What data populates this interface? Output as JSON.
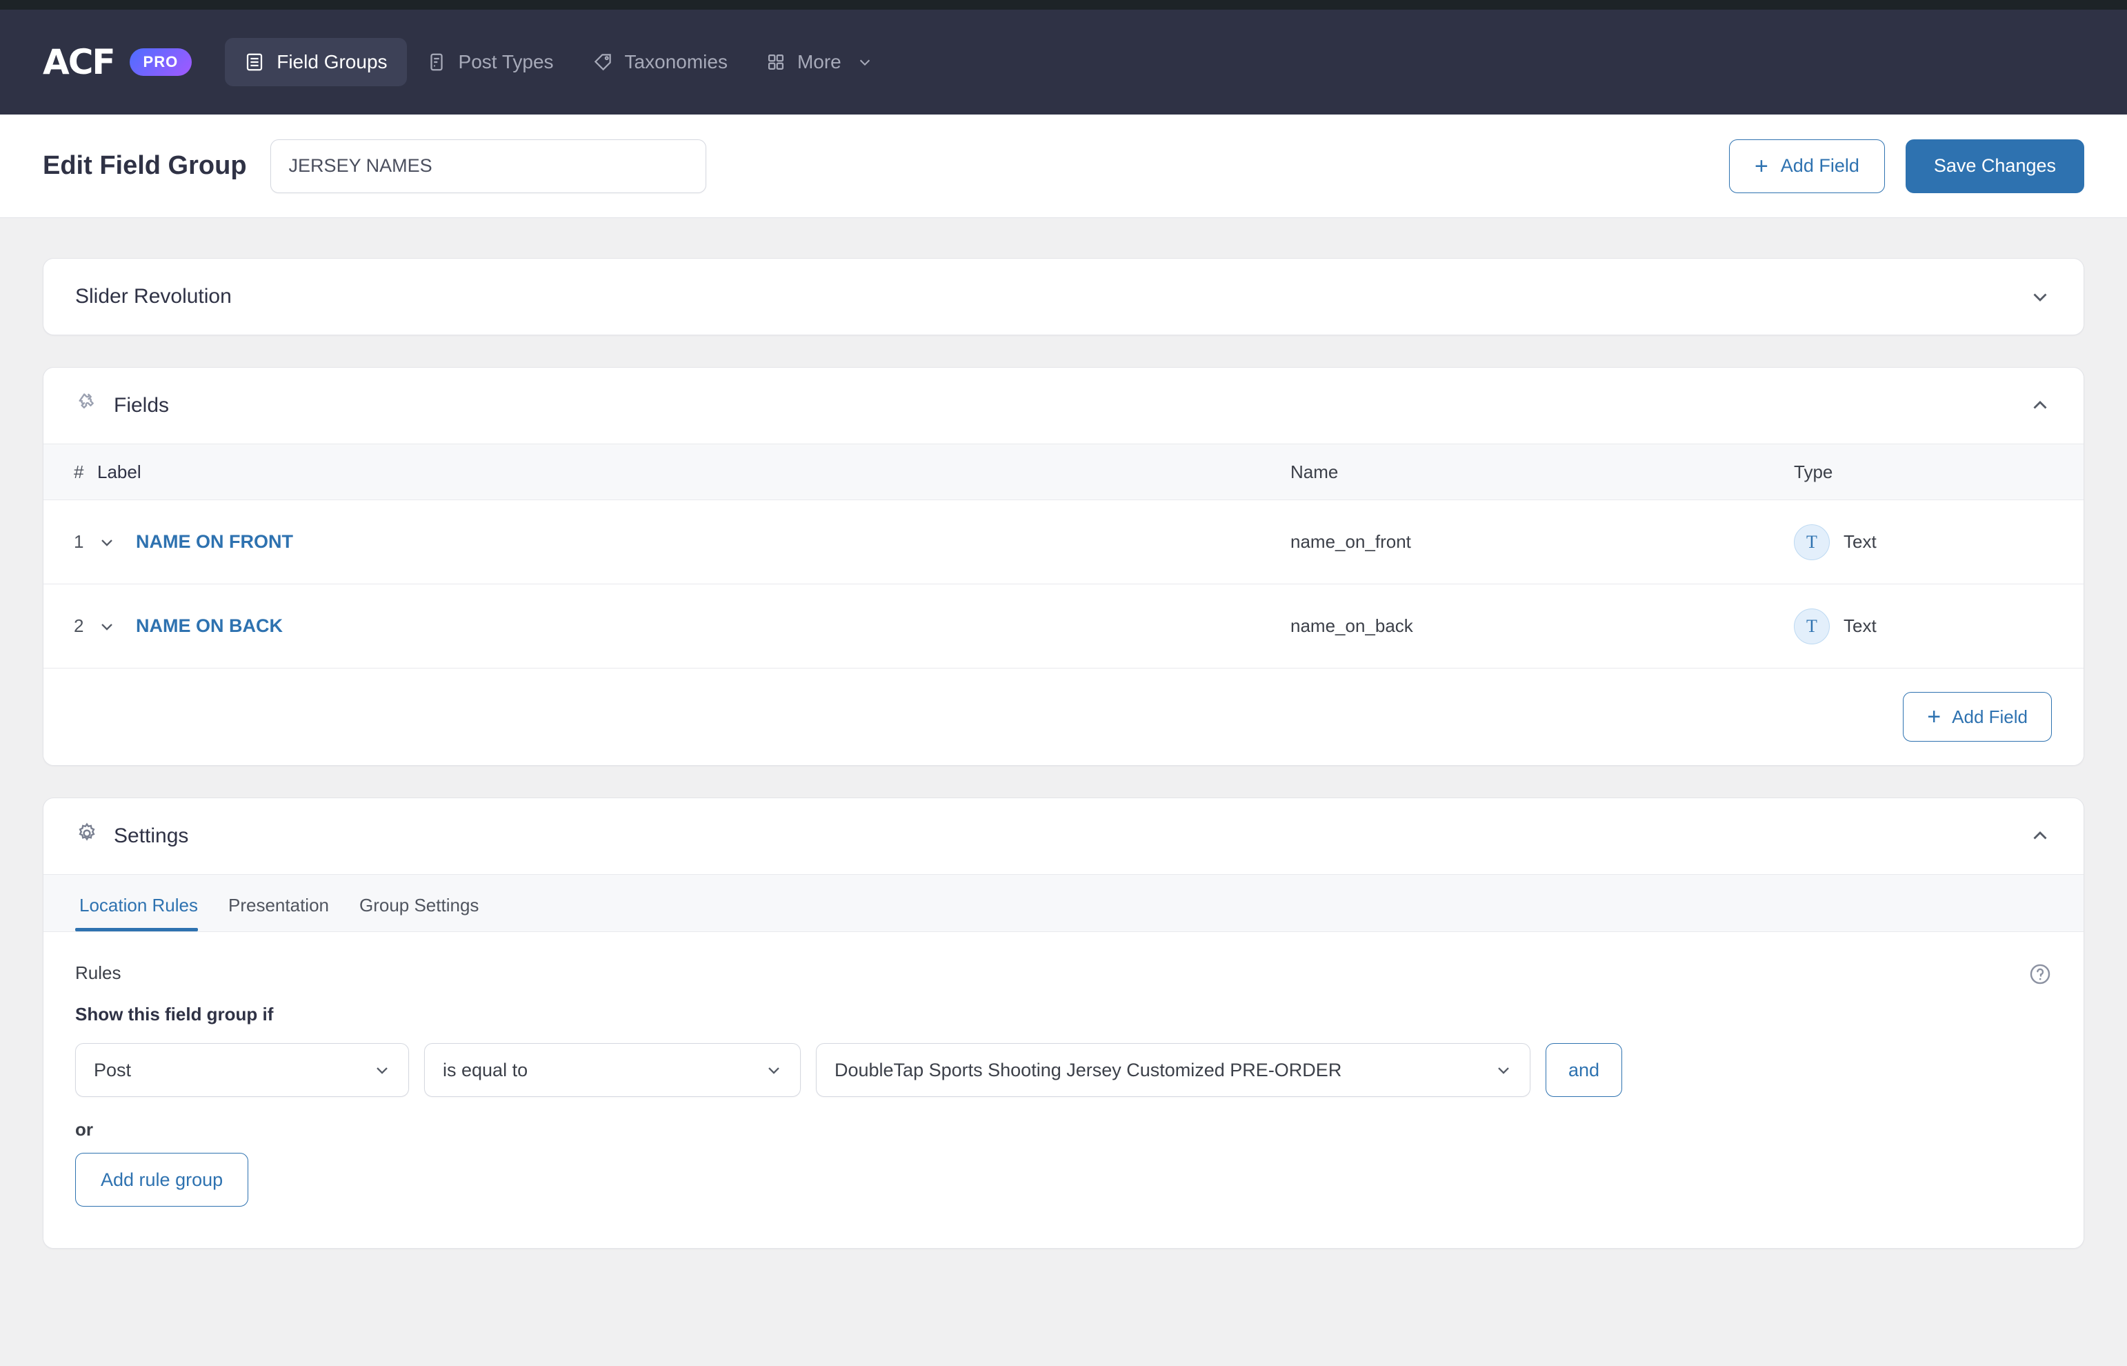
{
  "colors": {
    "nav_bg": "#2f3245",
    "accent_blue": "#2e72b0",
    "page_bg": "#f0f0f1",
    "pro_badge_gradient_start": "#4d6eff",
    "pro_badge_gradient_end": "#a259ff"
  },
  "nav": {
    "logo_text": "ACF",
    "pro_badge": "PRO",
    "items": [
      {
        "label": "Field Groups",
        "icon": "field-groups-icon",
        "active": true
      },
      {
        "label": "Post Types",
        "icon": "post-types-icon",
        "active": false
      },
      {
        "label": "Taxonomies",
        "icon": "taxonomies-tag-icon",
        "active": false
      },
      {
        "label": "More",
        "icon": "grid-icon",
        "active": false,
        "has_chevron": true
      }
    ]
  },
  "header": {
    "title": "Edit Field Group",
    "field_group_name": "JERSEY NAMES",
    "field_group_name_placeholder": "Add title",
    "add_field_label": "Add Field",
    "save_label": "Save Changes"
  },
  "panels": {
    "slider_revolution": {
      "title": "Slider Revolution",
      "collapsed": true,
      "toggle_icon": "chevron-down-icon"
    },
    "fields": {
      "title": "Fields",
      "icon": "puzzle-piece-icon",
      "collapsed": false,
      "toggle_icon": "chevron-up-icon",
      "columns": {
        "num": "#",
        "label": "Label",
        "name": "Name",
        "type": "Type"
      },
      "rows": [
        {
          "num": "1",
          "label": "NAME ON FRONT",
          "name": "name_on_front",
          "type": "Text",
          "type_glyph": "T"
        },
        {
          "num": "2",
          "label": "NAME ON BACK",
          "name": "name_on_back",
          "type": "Text",
          "type_glyph": "T"
        }
      ],
      "add_field_label": "Add Field"
    },
    "settings": {
      "title": "Settings",
      "icon": "gear-icon",
      "collapsed": false,
      "toggle_icon": "chevron-up-icon",
      "tabs": [
        {
          "label": "Location Rules",
          "active": true
        },
        {
          "label": "Presentation",
          "active": false
        },
        {
          "label": "Group Settings",
          "active": false
        }
      ],
      "location_rules": {
        "rules_label": "Rules",
        "help_icon": "question-mark-help-icon",
        "show_if_label": "Show this field group if",
        "rule": {
          "param": "Post",
          "operator": "is equal to",
          "value": "DoubleTap Sports Shooting Jersey Customized PRE-ORDER",
          "and_label": "and"
        },
        "or_label": "or",
        "add_rule_group_label": "Add rule group"
      }
    }
  }
}
